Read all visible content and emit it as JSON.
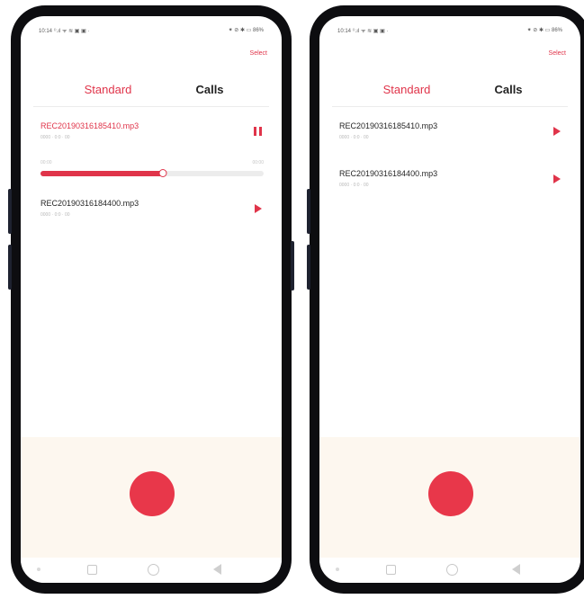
{
  "screens": [
    {
      "status_left": "10:14 ⁽⁾.ıl ᯤ ≋ ▣ ▣ ·",
      "status_right": "⁕ ⊘ ✱ ▭ 86%",
      "select_label": "Select",
      "tabs": {
        "standard": "Standard",
        "calls": "Calls"
      },
      "items": [
        {
          "name": "REC20190316185410.mp3",
          "sub": "0000 · 0:0 · 00",
          "state": "playing"
        },
        {
          "name": "REC20190316184400.mp3",
          "sub": "0000 · 0:0 · 00",
          "state": "stopped"
        }
      ],
      "player": {
        "elapsed": "00:00",
        "total": "00:00",
        "progress": 0.55
      }
    },
    {
      "status_left": "10:14 ⁽⁾.ıl ᯤ ≋ ▣ ▣ ·",
      "status_right": "⁕ ⊘ ✱ ▭ 86%",
      "select_label": "Select",
      "tabs": {
        "standard": "Standard",
        "calls": "Calls"
      },
      "items": [
        {
          "name": "REC20190316185410.mp3",
          "sub": "0000 · 0:0 · 00",
          "state": "stopped"
        },
        {
          "name": "REC20190316184400.mp3",
          "sub": "0000 · 0:0 · 00",
          "state": "stopped"
        }
      ]
    }
  ],
  "colors": {
    "accent": "#e0344a",
    "record": "#e8374a",
    "panel": "#fdf7ef",
    "bezel": "#0d0d10"
  },
  "icons": [
    "play-icon",
    "pause-icon",
    "record-icon",
    "recents-icon",
    "home-icon",
    "back-icon"
  ]
}
